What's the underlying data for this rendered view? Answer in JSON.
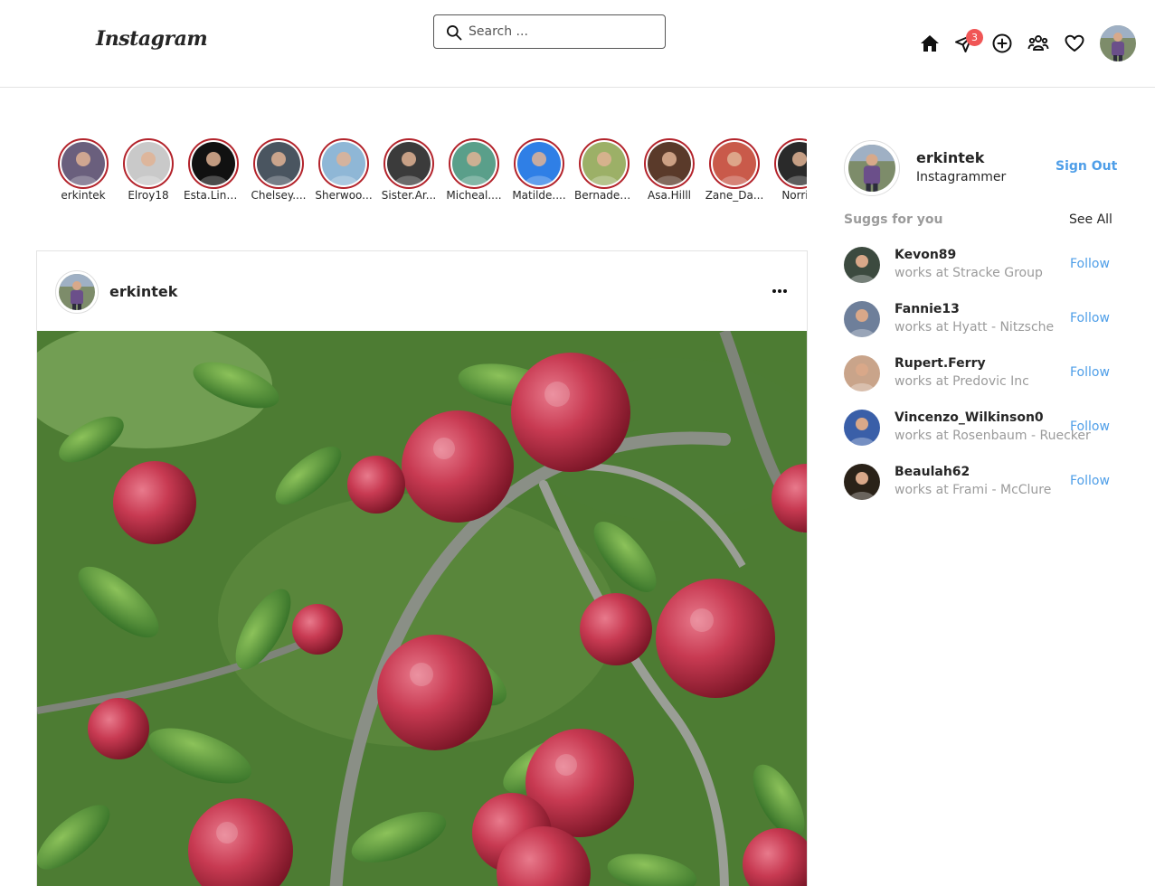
{
  "header": {
    "logo": "Instagram",
    "search_placeholder": "Search ...",
    "message_badge": "3",
    "icons": [
      "home-icon",
      "paper-plane-icon",
      "plus-circle-icon",
      "users-icon",
      "heart-icon"
    ]
  },
  "stories": [
    {
      "name": "erkintek",
      "color": "#6a5f7d"
    },
    {
      "name": "Elroy18",
      "color": "#c9c9c9"
    },
    {
      "name": "Esta.Lind...",
      "color": "#111111"
    },
    {
      "name": "Chelsey....",
      "color": "#4a5560"
    },
    {
      "name": "Sherwoo...",
      "color": "#8fb7d6"
    },
    {
      "name": "Sister.Ar...",
      "color": "#3b3b3b"
    },
    {
      "name": "Micheal....",
      "color": "#5a9f8a"
    },
    {
      "name": "Matilde....",
      "color": "#2f7fe6"
    },
    {
      "name": "Bernadet...",
      "color": "#9cb067"
    },
    {
      "name": "Asa.Hilll",
      "color": "#5a3a2a"
    },
    {
      "name": "Zane_Da...",
      "color": "#c95a4a"
    },
    {
      "name": "Norris.",
      "color": "#2a2a2a"
    }
  ],
  "post": {
    "username": "erkintek"
  },
  "profile": {
    "username": "erkintek",
    "subtitle": "Instagrammer",
    "sign_out": "Sign Out"
  },
  "suggestions": {
    "title": "Suggs for you",
    "see_all": "See All",
    "items": [
      {
        "username": "Kevon89",
        "work": "works at Stracke Group",
        "follow": "Follow",
        "color": "#3c4a3f"
      },
      {
        "username": "Fannie13",
        "work": "works at Hyatt - Nitzsche",
        "follow": "Follow",
        "color": "#6e7f9a"
      },
      {
        "username": "Rupert.Ferry",
        "work": "works at Predovic Inc",
        "follow": "Follow",
        "color": "#c9a48a"
      },
      {
        "username": "Vincenzo_Wilkinson0",
        "work": "works at Rosenbaum - Ruecker",
        "follow": "Follow",
        "color": "#3a5fa8"
      },
      {
        "username": "Beaulah62",
        "work": "works at Frami - McClure",
        "follow": "Follow",
        "color": "#2a2218"
      }
    ]
  },
  "colors": {
    "accent": "#4e9ee8",
    "story_ring": "#b3232b",
    "badge": "#f05656",
    "muted": "#9b9b9b"
  }
}
